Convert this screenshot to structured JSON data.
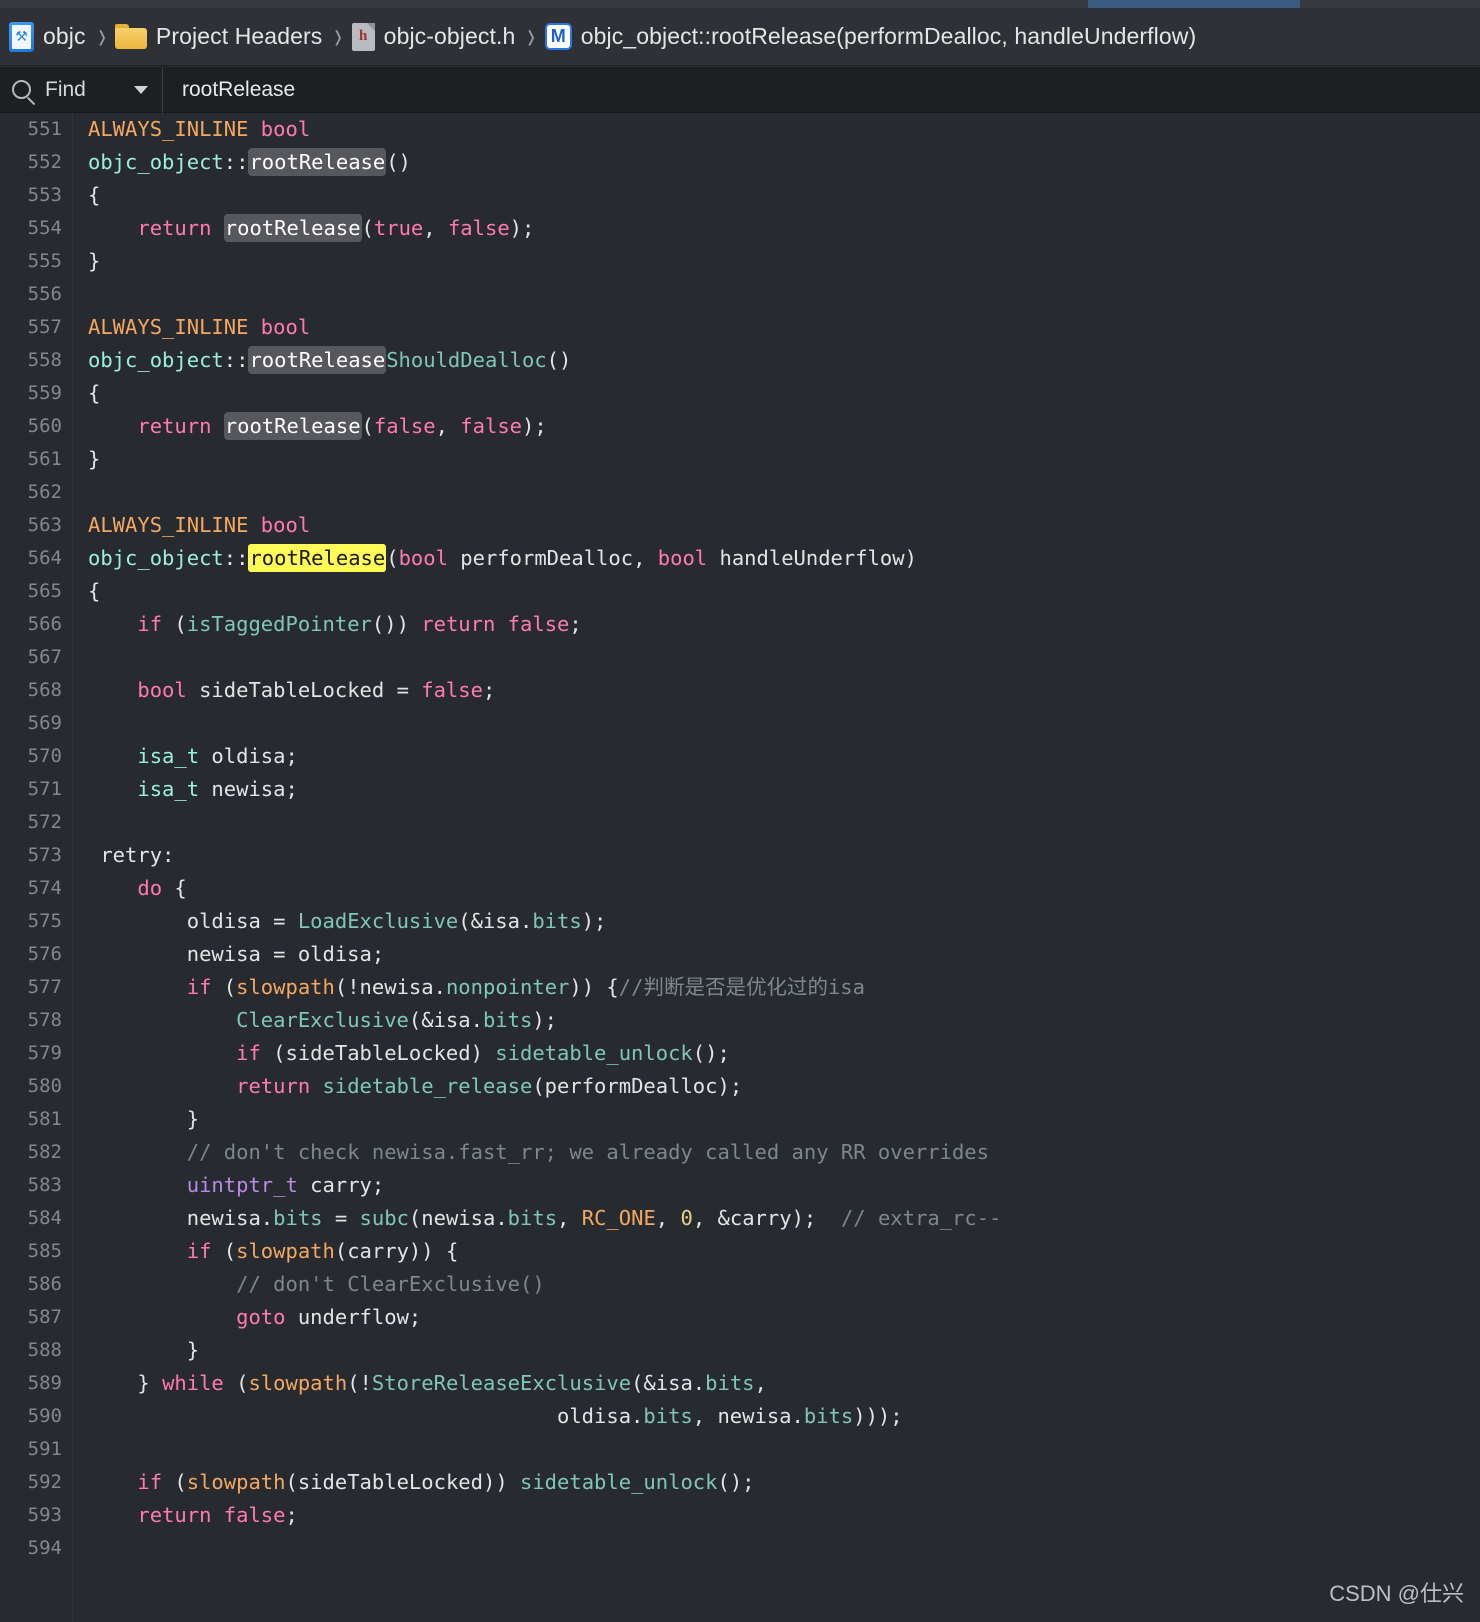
{
  "window": {
    "app": "Xcode",
    "accent_blue": "#3b5a80",
    "editor_bg": "#272a2e",
    "breadcrumb_bg": "#2f3136",
    "findbar_bg": "#1d1f22"
  },
  "tabstrip": {
    "active_tab_color": "#3b5a80",
    "inactive_tab_color": "#37393e"
  },
  "breadcrumb": {
    "items": [
      {
        "icon": "xcode-project-icon",
        "label": "objc"
      },
      {
        "icon": "folder-icon",
        "label": "Project Headers"
      },
      {
        "icon": "header-file-icon",
        "label": "objc-object.h",
        "icon_glyph": "h"
      },
      {
        "icon": "method-icon",
        "label": "objc_object::rootRelease(performDealloc, handleUnderflow)",
        "icon_glyph": "M"
      }
    ],
    "separator": "›"
  },
  "find_bar": {
    "scope_label": "Find",
    "query": "rootRelease",
    "placeholder": "Find",
    "search_icon": "search-icon",
    "dropdown_icon": "chevron-down-icon"
  },
  "editor": {
    "first_line": 551,
    "last_line": 594,
    "search_term": "rootRelease",
    "active_match_line": 564,
    "lines": [
      {
        "n": 551,
        "tokens": [
          {
            "t": "ALWAYS_INLINE",
            "c": "t-macro"
          },
          {
            "t": " ",
            "c": "t-ident"
          },
          {
            "t": "bool",
            "c": "t-kw"
          }
        ]
      },
      {
        "n": 552,
        "tokens": [
          {
            "t": "objc_object",
            "c": "t-type"
          },
          {
            "t": "::",
            "c": "t-ident"
          },
          {
            "t": "rootRelease",
            "c": "t-ident",
            "hl": "gray"
          },
          {
            "t": "()",
            "c": "t-ident"
          }
        ]
      },
      {
        "n": 553,
        "tokens": [
          {
            "t": "{",
            "c": "t-ident"
          }
        ]
      },
      {
        "n": 554,
        "tokens": [
          {
            "t": "    ",
            "c": "t-ident"
          },
          {
            "t": "return",
            "c": "t-kw"
          },
          {
            "t": " ",
            "c": "t-ident"
          },
          {
            "t": "rootRelease",
            "c": "t-ident",
            "hl": "gray"
          },
          {
            "t": "(",
            "c": "t-ident"
          },
          {
            "t": "true",
            "c": "t-kw"
          },
          {
            "t": ", ",
            "c": "t-ident"
          },
          {
            "t": "false",
            "c": "t-kw"
          },
          {
            "t": ");",
            "c": "t-ident"
          }
        ]
      },
      {
        "n": 555,
        "tokens": [
          {
            "t": "}",
            "c": "t-ident"
          }
        ]
      },
      {
        "n": 556,
        "tokens": []
      },
      {
        "n": 557,
        "tokens": [
          {
            "t": "ALWAYS_INLINE",
            "c": "t-macro"
          },
          {
            "t": " ",
            "c": "t-ident"
          },
          {
            "t": "bool",
            "c": "t-kw"
          }
        ]
      },
      {
        "n": 558,
        "tokens": [
          {
            "t": "objc_object",
            "c": "t-type"
          },
          {
            "t": "::",
            "c": "t-ident"
          },
          {
            "t": "rootRelease",
            "c": "t-ident",
            "hl": "gray"
          },
          {
            "t": "ShouldDealloc",
            "c": "t-member"
          },
          {
            "t": "()",
            "c": "t-ident"
          }
        ]
      },
      {
        "n": 559,
        "tokens": [
          {
            "t": "{",
            "c": "t-ident"
          }
        ]
      },
      {
        "n": 560,
        "tokens": [
          {
            "t": "    ",
            "c": "t-ident"
          },
          {
            "t": "return",
            "c": "t-kw"
          },
          {
            "t": " ",
            "c": "t-ident"
          },
          {
            "t": "rootRelease",
            "c": "t-ident",
            "hl": "gray"
          },
          {
            "t": "(",
            "c": "t-ident"
          },
          {
            "t": "false",
            "c": "t-kw"
          },
          {
            "t": ", ",
            "c": "t-ident"
          },
          {
            "t": "false",
            "c": "t-kw"
          },
          {
            "t": ");",
            "c": "t-ident"
          }
        ]
      },
      {
        "n": 561,
        "tokens": [
          {
            "t": "}",
            "c": "t-ident"
          }
        ]
      },
      {
        "n": 562,
        "tokens": []
      },
      {
        "n": 563,
        "tokens": [
          {
            "t": "ALWAYS_INLINE",
            "c": "t-macro"
          },
          {
            "t": " ",
            "c": "t-ident"
          },
          {
            "t": "bool",
            "c": "t-kw"
          }
        ]
      },
      {
        "n": 564,
        "tokens": [
          {
            "t": "objc_object",
            "c": "t-type"
          },
          {
            "t": "::",
            "c": "t-ident"
          },
          {
            "t": "rootRelease",
            "c": "t-ident",
            "hl": "yellow"
          },
          {
            "t": "(",
            "c": "t-ident"
          },
          {
            "t": "bool",
            "c": "t-kw"
          },
          {
            "t": " performDealloc, ",
            "c": "t-ident"
          },
          {
            "t": "bool",
            "c": "t-kw"
          },
          {
            "t": " handleUnderflow)",
            "c": "t-ident"
          }
        ]
      },
      {
        "n": 565,
        "tokens": [
          {
            "t": "{",
            "c": "t-ident"
          }
        ]
      },
      {
        "n": 566,
        "tokens": [
          {
            "t": "    ",
            "c": "t-ident"
          },
          {
            "t": "if",
            "c": "t-kw"
          },
          {
            "t": " (",
            "c": "t-ident"
          },
          {
            "t": "isTaggedPointer",
            "c": "t-func"
          },
          {
            "t": "()) ",
            "c": "t-ident"
          },
          {
            "t": "return",
            "c": "t-kw"
          },
          {
            "t": " ",
            "c": "t-ident"
          },
          {
            "t": "false",
            "c": "t-kw"
          },
          {
            "t": ";",
            "c": "t-ident"
          }
        ]
      },
      {
        "n": 567,
        "tokens": []
      },
      {
        "n": 568,
        "tokens": [
          {
            "t": "    ",
            "c": "t-ident"
          },
          {
            "t": "bool",
            "c": "t-kw"
          },
          {
            "t": " sideTableLocked = ",
            "c": "t-ident"
          },
          {
            "t": "false",
            "c": "t-kw"
          },
          {
            "t": ";",
            "c": "t-ident"
          }
        ]
      },
      {
        "n": 569,
        "tokens": []
      },
      {
        "n": 570,
        "tokens": [
          {
            "t": "    ",
            "c": "t-ident"
          },
          {
            "t": "isa_t",
            "c": "t-type"
          },
          {
            "t": " oldisa;",
            "c": "t-ident"
          }
        ]
      },
      {
        "n": 571,
        "tokens": [
          {
            "t": "    ",
            "c": "t-ident"
          },
          {
            "t": "isa_t",
            "c": "t-type"
          },
          {
            "t": " newisa;",
            "c": "t-ident"
          }
        ]
      },
      {
        "n": 572,
        "tokens": []
      },
      {
        "n": 573,
        "tokens": [
          {
            "t": " retry:",
            "c": "t-ident"
          }
        ]
      },
      {
        "n": 574,
        "tokens": [
          {
            "t": "    ",
            "c": "t-ident"
          },
          {
            "t": "do",
            "c": "t-kw"
          },
          {
            "t": " {",
            "c": "t-ident"
          }
        ]
      },
      {
        "n": 575,
        "tokens": [
          {
            "t": "        oldisa = ",
            "c": "t-ident"
          },
          {
            "t": "LoadExclusive",
            "c": "t-func"
          },
          {
            "t": "(&isa.",
            "c": "t-ident"
          },
          {
            "t": "bits",
            "c": "t-member"
          },
          {
            "t": ");",
            "c": "t-ident"
          }
        ]
      },
      {
        "n": 576,
        "tokens": [
          {
            "t": "        newisa = oldisa;",
            "c": "t-ident"
          }
        ]
      },
      {
        "n": 577,
        "tokens": [
          {
            "t": "        ",
            "c": "t-ident"
          },
          {
            "t": "if",
            "c": "t-kw"
          },
          {
            "t": " (",
            "c": "t-ident"
          },
          {
            "t": "slowpath",
            "c": "t-macro"
          },
          {
            "t": "(!newisa.",
            "c": "t-ident"
          },
          {
            "t": "nonpointer",
            "c": "t-member"
          },
          {
            "t": ")) {",
            "c": "t-ident"
          },
          {
            "t": "//判断是否是优化过的isa",
            "c": "t-cmt"
          }
        ]
      },
      {
        "n": 578,
        "tokens": [
          {
            "t": "            ",
            "c": "t-ident"
          },
          {
            "t": "ClearExclusive",
            "c": "t-func"
          },
          {
            "t": "(&isa.",
            "c": "t-ident"
          },
          {
            "t": "bits",
            "c": "t-member"
          },
          {
            "t": ");",
            "c": "t-ident"
          }
        ]
      },
      {
        "n": 579,
        "tokens": [
          {
            "t": "            ",
            "c": "t-ident"
          },
          {
            "t": "if",
            "c": "t-kw"
          },
          {
            "t": " (sideTableLocked) ",
            "c": "t-ident"
          },
          {
            "t": "sidetable_unlock",
            "c": "t-func"
          },
          {
            "t": "();",
            "c": "t-ident"
          }
        ]
      },
      {
        "n": 580,
        "tokens": [
          {
            "t": "            ",
            "c": "t-ident"
          },
          {
            "t": "return",
            "c": "t-kw"
          },
          {
            "t": " ",
            "c": "t-ident"
          },
          {
            "t": "sidetable_release",
            "c": "t-func"
          },
          {
            "t": "(performDealloc);",
            "c": "t-ident"
          }
        ]
      },
      {
        "n": 581,
        "tokens": [
          {
            "t": "        }",
            "c": "t-ident"
          }
        ]
      },
      {
        "n": 582,
        "tokens": [
          {
            "t": "        ",
            "c": "t-ident"
          },
          {
            "t": "// don't check newisa.fast_rr; we already called any RR overrides",
            "c": "t-cmt"
          }
        ]
      },
      {
        "n": 583,
        "tokens": [
          {
            "t": "        ",
            "c": "t-ident"
          },
          {
            "t": "uintptr_t",
            "c": "t-purple"
          },
          {
            "t": " carry;",
            "c": "t-ident"
          }
        ]
      },
      {
        "n": 584,
        "tokens": [
          {
            "t": "        newisa.",
            "c": "t-ident"
          },
          {
            "t": "bits",
            "c": "t-member"
          },
          {
            "t": " = ",
            "c": "t-ident"
          },
          {
            "t": "subc",
            "c": "t-func"
          },
          {
            "t": "(newisa.",
            "c": "t-ident"
          },
          {
            "t": "bits",
            "c": "t-member"
          },
          {
            "t": ", ",
            "c": "t-ident"
          },
          {
            "t": "RC_ONE",
            "c": "t-macro"
          },
          {
            "t": ", ",
            "c": "t-ident"
          },
          {
            "t": "0",
            "c": "t-num"
          },
          {
            "t": ", &carry);  ",
            "c": "t-ident"
          },
          {
            "t": "// extra_rc--",
            "c": "t-cmt"
          }
        ]
      },
      {
        "n": 585,
        "tokens": [
          {
            "t": "        ",
            "c": "t-ident"
          },
          {
            "t": "if",
            "c": "t-kw"
          },
          {
            "t": " (",
            "c": "t-ident"
          },
          {
            "t": "slowpath",
            "c": "t-macro"
          },
          {
            "t": "(carry)) {",
            "c": "t-ident"
          }
        ]
      },
      {
        "n": 586,
        "tokens": [
          {
            "t": "            ",
            "c": "t-ident"
          },
          {
            "t": "// don't ClearExclusive()",
            "c": "t-cmt"
          }
        ]
      },
      {
        "n": 587,
        "tokens": [
          {
            "t": "            ",
            "c": "t-ident"
          },
          {
            "t": "goto",
            "c": "t-kw"
          },
          {
            "t": " underflow;",
            "c": "t-ident"
          }
        ]
      },
      {
        "n": 588,
        "tokens": [
          {
            "t": "        }",
            "c": "t-ident"
          }
        ]
      },
      {
        "n": 589,
        "tokens": [
          {
            "t": "    } ",
            "c": "t-ident"
          },
          {
            "t": "while",
            "c": "t-kw"
          },
          {
            "t": " (",
            "c": "t-ident"
          },
          {
            "t": "slowpath",
            "c": "t-macro"
          },
          {
            "t": "(!",
            "c": "t-ident"
          },
          {
            "t": "StoreReleaseExclusive",
            "c": "t-func"
          },
          {
            "t": "(&isa.",
            "c": "t-ident"
          },
          {
            "t": "bits",
            "c": "t-member"
          },
          {
            "t": ",",
            "c": "t-ident"
          }
        ]
      },
      {
        "n": 590,
        "tokens": [
          {
            "t": "                                      oldisa.",
            "c": "t-ident"
          },
          {
            "t": "bits",
            "c": "t-member"
          },
          {
            "t": ", newisa.",
            "c": "t-ident"
          },
          {
            "t": "bits",
            "c": "t-member"
          },
          {
            "t": ")));",
            "c": "t-ident"
          }
        ]
      },
      {
        "n": 591,
        "tokens": []
      },
      {
        "n": 592,
        "tokens": [
          {
            "t": "    ",
            "c": "t-ident"
          },
          {
            "t": "if",
            "c": "t-kw"
          },
          {
            "t": " (",
            "c": "t-ident"
          },
          {
            "t": "slowpath",
            "c": "t-macro"
          },
          {
            "t": "(sideTableLocked)) ",
            "c": "t-ident"
          },
          {
            "t": "sidetable_unlock",
            "c": "t-func"
          },
          {
            "t": "();",
            "c": "t-ident"
          }
        ]
      },
      {
        "n": 593,
        "tokens": [
          {
            "t": "    ",
            "c": "t-ident"
          },
          {
            "t": "return",
            "c": "t-kw"
          },
          {
            "t": " ",
            "c": "t-ident"
          },
          {
            "t": "false",
            "c": "t-kw"
          },
          {
            "t": ";",
            "c": "t-ident"
          }
        ]
      },
      {
        "n": 594,
        "tokens": []
      }
    ]
  },
  "watermark": {
    "text": "CSDN @仕兴"
  }
}
